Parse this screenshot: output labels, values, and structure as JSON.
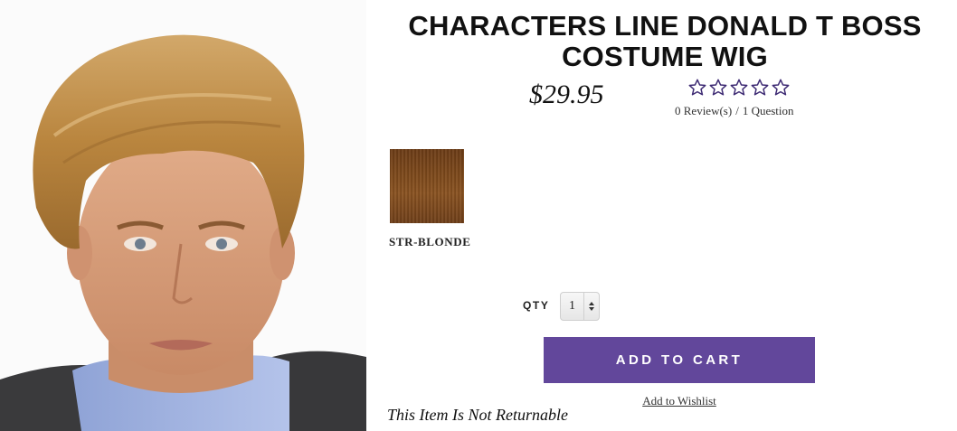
{
  "product": {
    "title": "CHARACTERS LINE DONALD T BOSS COSTUME WIG",
    "price": "$29.95",
    "rating": 0,
    "rating_max": 5,
    "reviews_text": "0 Review(s)",
    "separator": "/",
    "questions_text": "1 Question",
    "image_alt": "Man wearing blonde costume wig"
  },
  "swatch": {
    "label": "STR-BLONDE",
    "color": "#7e4a1c"
  },
  "purchase": {
    "qty_label": "QTY",
    "qty_value": "1",
    "add_to_cart_label": "ADD TO CART",
    "wishlist_label": "Add to Wishlist",
    "notice": "This Item Is Not Returnable"
  },
  "colors": {
    "accent": "#62479b",
    "star_outline": "#3d2a73"
  }
}
